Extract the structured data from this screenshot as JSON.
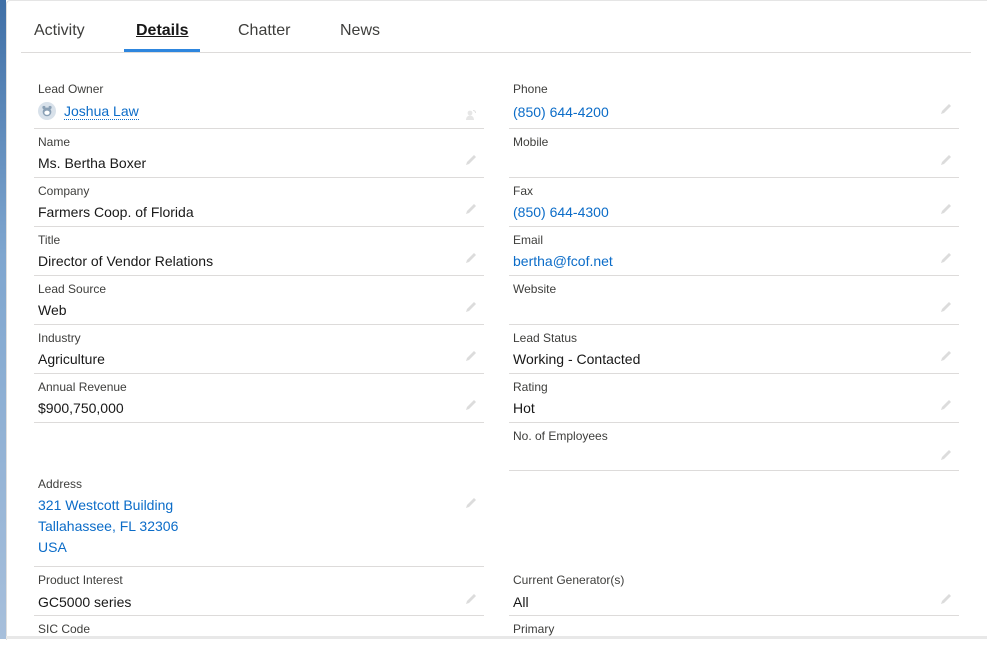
{
  "tabs": [
    {
      "label": "Activity",
      "active": false
    },
    {
      "label": "Details",
      "active": true
    },
    {
      "label": "Chatter",
      "active": false
    },
    {
      "label": "News",
      "active": false
    }
  ],
  "accent_color": "#2e86de",
  "link_color": "#0b6cc8",
  "left_column": {
    "lead_owner": {
      "label": "Lead Owner",
      "value": "Joshua Law",
      "avatar_icon": "user-avatar-icon",
      "action_icon": "change-owner-icon"
    },
    "name": {
      "label": "Name",
      "value": "Ms. Bertha Boxer"
    },
    "company": {
      "label": "Company",
      "value": "Farmers Coop. of Florida"
    },
    "title": {
      "label": "Title",
      "value": "Director of Vendor Relations"
    },
    "lead_source": {
      "label": "Lead Source",
      "value": "Web"
    },
    "industry": {
      "label": "Industry",
      "value": "Agriculture"
    },
    "annual_revenue": {
      "label": "Annual Revenue",
      "value": "$900,750,000"
    },
    "address": {
      "label": "Address",
      "line1": "321 Westcott Building",
      "line2": "Tallahassee, FL 32306",
      "line3": "USA"
    },
    "product_interest": {
      "label": "Product Interest",
      "value": "GC5000 series"
    },
    "sic_code": {
      "label": "SIC Code",
      "value": ""
    }
  },
  "right_column": {
    "phone": {
      "label": "Phone",
      "value": "(850) 644-4200"
    },
    "mobile": {
      "label": "Mobile",
      "value": ""
    },
    "fax": {
      "label": "Fax",
      "value": "(850) 644-4300"
    },
    "email": {
      "label": "Email",
      "value": "bertha@fcof.net"
    },
    "website": {
      "label": "Website",
      "value": ""
    },
    "lead_status": {
      "label": "Lead Status",
      "value": "Working - Contacted"
    },
    "rating": {
      "label": "Rating",
      "value": "Hot"
    },
    "no_of_employees": {
      "label": "No. of Employees",
      "value": ""
    },
    "current_generators": {
      "label": "Current Generator(s)",
      "value": "All"
    },
    "primary": {
      "label": "Primary",
      "value": ""
    }
  },
  "icons": {
    "edit": "pencil-icon"
  }
}
